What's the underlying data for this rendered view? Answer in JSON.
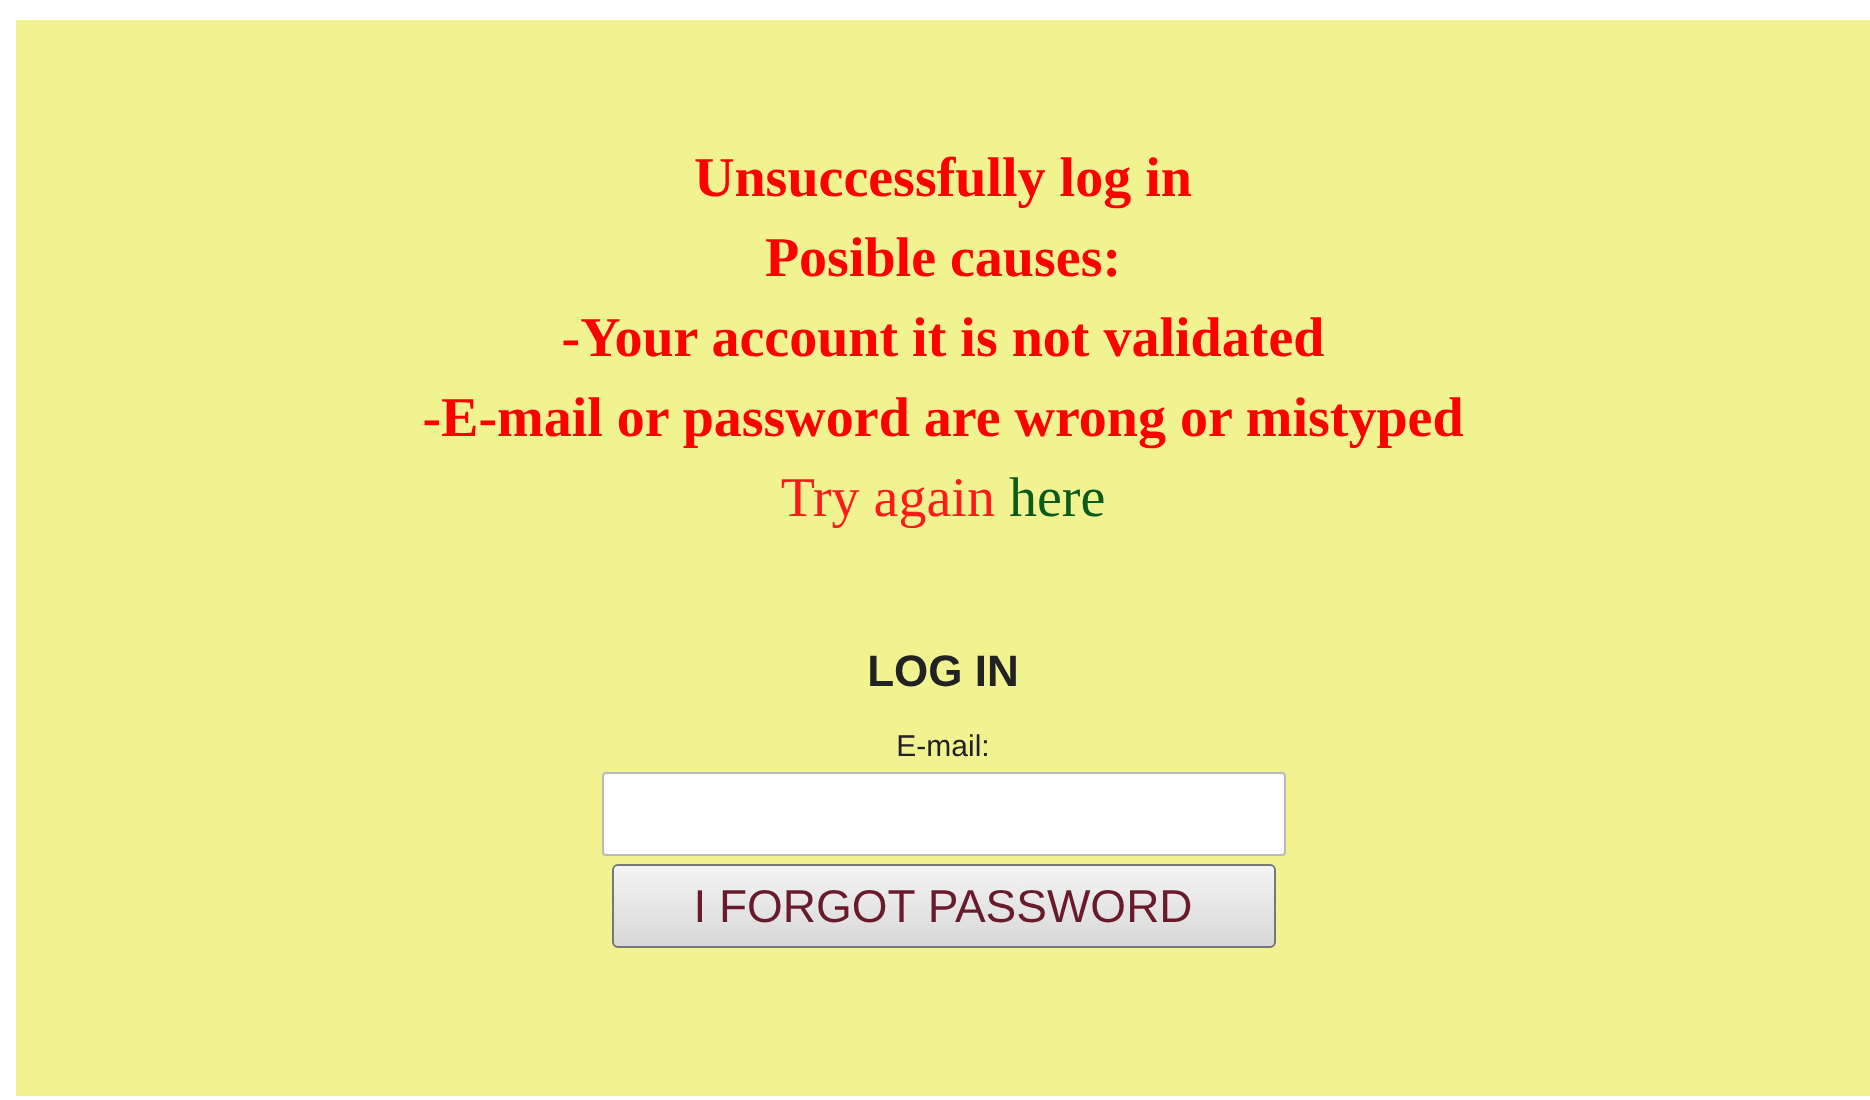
{
  "error": {
    "title": "Unsuccessfully log in",
    "subtitle": "Posible causes:",
    "causes": [
      "-Your account it is not validated",
      "-E-mail or password are wrong or mistyped"
    ]
  },
  "retry": {
    "text": "Try again",
    "link": "here"
  },
  "login": {
    "heading": "LOG IN",
    "email_label": "E-mail:",
    "button": "I FORGOT PASSWORD"
  }
}
